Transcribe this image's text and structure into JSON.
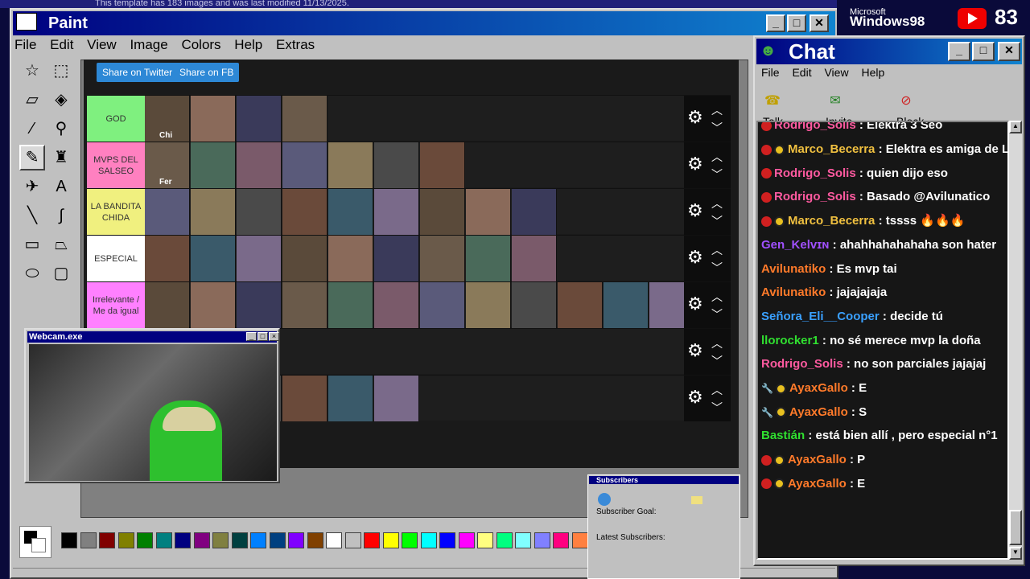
{
  "banner": {
    "text": "This template has 183 images and was last modified 11/13/2025."
  },
  "paint": {
    "title": "Paint",
    "menu": [
      "File",
      "Edit",
      "View",
      "Image",
      "Colors",
      "Help",
      "Extras"
    ],
    "share_twitter": "Share on Twitter",
    "share_fb": "Share on FB",
    "tiers": [
      {
        "label": "GOD",
        "color": "#7ff07f",
        "items": 4
      },
      {
        "label": "MVPS DEL SALSEO",
        "color": "#ff80c0",
        "items": 7
      },
      {
        "label": "LA BANDITA CHIDA",
        "color": "#f0f07f",
        "items": 9
      },
      {
        "label": "ESPECIAL",
        "color": "#ffffff",
        "items": 9
      },
      {
        "label": "Irrelevante / Me da igual",
        "color": "#ff80ff",
        "items": 12
      },
      {
        "label": "",
        "color": "#1e1e1e",
        "items": 0
      },
      {
        "label": "",
        "color": "#1e1e1e",
        "items": 6
      }
    ],
    "thumb_captions": {
      "god_1": "Chi",
      "mvps_1": "Fer"
    },
    "palette": [
      "#000000",
      "#808080",
      "#800000",
      "#808000",
      "#008000",
      "#008080",
      "#000080",
      "#800080",
      "#808040",
      "#004040",
      "#0080ff",
      "#004080",
      "#8000ff",
      "#804000",
      "#ffffff",
      "#c0c0c0",
      "#ff0000",
      "#ffff00",
      "#00ff00",
      "#00ffff",
      "#0000ff",
      "#ff00ff",
      "#ffff80",
      "#00ff80",
      "#80ffff",
      "#8080ff",
      "#ff0080",
      "#ff8040"
    ]
  },
  "webcam": {
    "title": "Webcam.exe"
  },
  "subscribers": {
    "title": "Subscribers",
    "goal": "Subscriber Goal:",
    "latest": "Latest Subscribers:"
  },
  "win98": {
    "line1": "Microsoft",
    "line2": "Windows98"
  },
  "youtube": {
    "count": "83"
  },
  "chat": {
    "title": "Chat",
    "menu": [
      "File",
      "Edit",
      "View",
      "Help"
    ],
    "tools": [
      "Talk",
      "Invite",
      "Block"
    ],
    "messages": [
      {
        "user": "Rodrigo_Solis",
        "color": "#ff5aa0",
        "text": "Elektra 3 Seo",
        "badges": "live"
      },
      {
        "user": "Marco_Becerra",
        "color": "#f0c040",
        "text": "Elektra es amiga de Lina y",
        "badges": "live-sub"
      },
      {
        "user": "Rodrigo_Solis",
        "color": "#ff5aa0",
        "text": "quien dijo eso",
        "badges": "live"
      },
      {
        "user": "Rodrigo_Solis",
        "color": "#ff5aa0",
        "text": "Basado @Avilunatico",
        "badges": "live"
      },
      {
        "user": "Marco_Becerra",
        "color": "#f0c040",
        "text": "tssss 🔥🔥🔥",
        "badges": "live-sub"
      },
      {
        "user": "Gen_Kelvɪɴ",
        "color": "#a050ff",
        "text": "ahahhahahahaha son hater",
        "badges": "none"
      },
      {
        "user": "Avilunatiko",
        "color": "#ff7a2a",
        "text": "Es mvp tai",
        "badges": "none"
      },
      {
        "user": "Avilunatiko",
        "color": "#ff7a2a",
        "text": "jajajajaja",
        "badges": "none"
      },
      {
        "user": "Señora_Eli__Cooper",
        "color": "#3aa0ff",
        "text": "decide tú",
        "badges": "none"
      },
      {
        "user": "llorocker1",
        "color": "#30e030",
        "text": "no sé merece mvp la doña",
        "badges": "none"
      },
      {
        "user": "Rodrigo_Solis",
        "color": "#ff5aa0",
        "text": "no son parciales jajajaj",
        "badges": "none"
      },
      {
        "user": "AyaxGallo",
        "color": "#ff7a2a",
        "text": "E",
        "badges": "mod-sub"
      },
      {
        "user": "AyaxGallo",
        "color": "#ff7a2a",
        "text": "S",
        "badges": "mod-sub"
      },
      {
        "user": "Bastián",
        "color": "#30e030",
        "text": "está bien allí , pero especial n°1",
        "badges": "none"
      },
      {
        "user": "AyaxGallo",
        "color": "#ff7a2a",
        "text": "P",
        "badges": "live-sub"
      },
      {
        "user": "AyaxGallo",
        "color": "#ff7a2a",
        "text": "E",
        "badges": "live-sub"
      }
    ]
  }
}
